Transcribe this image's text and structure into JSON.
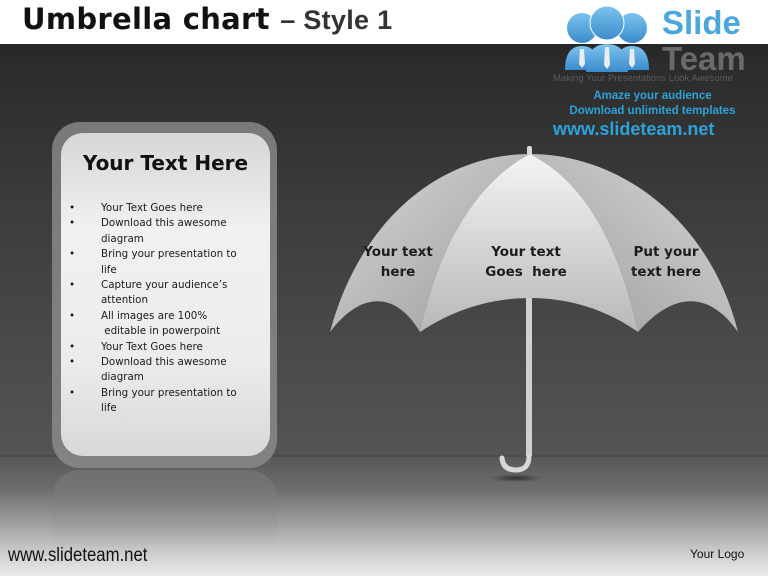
{
  "slide": {
    "title": "Umbrella chart",
    "title_suffix": "– Style 1"
  },
  "logo": {
    "icon": "people-group-icon",
    "word1": "Slide",
    "word2": "Team",
    "tagline": "Making Your Presentations Look Awesome",
    "promo_line1": "Amaze your audience",
    "promo_line2": "Download unlimited templates",
    "promo_url": "www.slideteam.net",
    "brand_color": "#2ba3d8"
  },
  "card": {
    "heading": "Your Text Here",
    "bullet_symbol": "•",
    "items": [
      {
        "lines": [
          "Your Text Goes here"
        ]
      },
      {
        "lines": [
          "Download this awesome",
          "diagram"
        ]
      },
      {
        "lines": [
          "Bring your presentation to",
          "life"
        ]
      },
      {
        "lines": [
          "Capture your audience’s",
          "attention"
        ]
      },
      {
        "lines": [
          "All images are 100%",
          " editable in powerpoint"
        ]
      },
      {
        "lines": [
          "Your Text Goes here"
        ]
      },
      {
        "lines": [
          "Download this awesome",
          "diagram"
        ]
      },
      {
        "lines": [
          "Bring your presentation to",
          "life"
        ]
      }
    ]
  },
  "umbrella": {
    "panels": [
      {
        "line1": "Your text",
        "line2": "here"
      },
      {
        "line1": "Your text",
        "line2": "Goes  here"
      },
      {
        "line1": "Put your",
        "line2": "text here"
      }
    ]
  },
  "footer": {
    "url": "www.slideteam.net",
    "logo_placeholder": "Your Logo"
  }
}
